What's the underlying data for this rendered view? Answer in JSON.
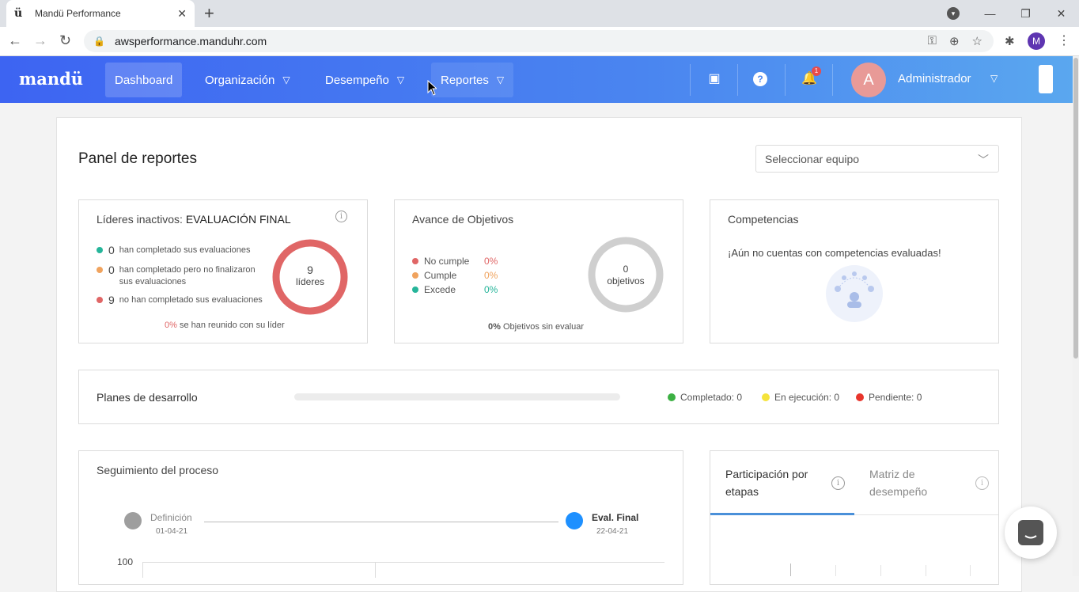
{
  "browser": {
    "tab_title": "Mandü Performance",
    "url": "awsperformance.manduhr.com",
    "profile_initial": "M"
  },
  "app": {
    "logo": "mandü",
    "nav": {
      "dashboard": "Dashboard",
      "organizacion": "Organización",
      "desempeno": "Desempeño",
      "reportes": "Reportes"
    },
    "notification_count": "1",
    "user_initial": "A",
    "user_name": "Administrador"
  },
  "page": {
    "title": "Panel de reportes",
    "team_select_placeholder": "Seleccionar equipo"
  },
  "lideres": {
    "title_prefix": "Líderes inactivos: ",
    "title_suffix": "EVALUACIÓN FINAL",
    "rows": [
      {
        "num": "0",
        "text": "han completado sus evaluaciones",
        "color": "#26b59a"
      },
      {
        "num": "0",
        "text": "han completado pero no finalizaron sus evaluaciones",
        "color": "#f0a35e"
      },
      {
        "num": "9",
        "text": "no han completado sus evaluaciones",
        "color": "#e06666"
      }
    ],
    "ring_num": "9",
    "ring_label": "líderes",
    "footer_pct": "0%",
    "footer_text": " se han reunido con su líder"
  },
  "objetivos": {
    "title": "Avance de Objetivos",
    "legend": [
      {
        "label": "No cumple",
        "pct": "0%",
        "color": "#e06666"
      },
      {
        "label": "Cumple",
        "pct": "0%",
        "color": "#f0a35e"
      },
      {
        "label": "Excede",
        "pct": "0%",
        "color": "#26b59a"
      }
    ],
    "ring_num": "0",
    "ring_label": "objetivos",
    "footer_pct": "0%",
    "footer_text": " Objetivos sin evaluar"
  },
  "competencias": {
    "title": "Competencias",
    "empty_text": "¡Aún no cuentas con competencias evaluadas!"
  },
  "planes": {
    "title": "Planes de desarrollo",
    "progress": 0,
    "legend": [
      {
        "label": "Completado: 0",
        "color": "#3cb043"
      },
      {
        "label": "En ejecución: 0",
        "color": "#f5e33b"
      },
      {
        "label": "Pendiente: 0",
        "color": "#e8352c"
      }
    ]
  },
  "seguimiento": {
    "title": "Seguimiento del proceso",
    "stages": [
      {
        "name": "Definición",
        "date": "01-04-21",
        "color": "#9e9e9e"
      },
      {
        "name": "Eval. Final",
        "date": "22-04-21",
        "color": "#1e90ff"
      }
    ],
    "y_tick": "100"
  },
  "participacion": {
    "tab1": "Participación por etapas",
    "tab2": "Matriz de desempeño"
  }
}
